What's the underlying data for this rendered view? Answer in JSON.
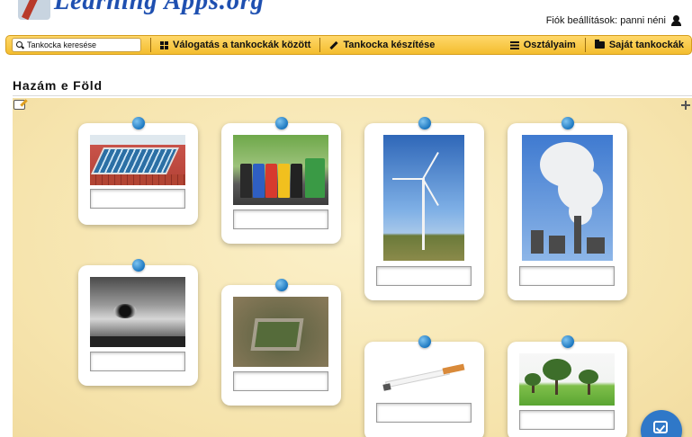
{
  "header": {
    "logo_text": "Learning Apps.org",
    "account_label": "Fiók beállítások: panni néni"
  },
  "nav": {
    "search_placeholder": "Tankocka keresése",
    "items": [
      {
        "label": "Válogatás a tankockák között",
        "icon": "grid-icon"
      },
      {
        "label": "Tankocka készítése",
        "icon": "pencil-icon"
      },
      {
        "label": "Osztályaim",
        "icon": "list-icon"
      },
      {
        "label": "Saját tankockák",
        "icon": "folder-icon"
      }
    ]
  },
  "page": {
    "title": "Hazám e Föld"
  },
  "board": {
    "cards": [
      {
        "image": "solar-panels-on-roof",
        "answer": ""
      },
      {
        "image": "recycling-bins",
        "answer": ""
      },
      {
        "image": "wind-turbine",
        "answer": ""
      },
      {
        "image": "factory-smoke",
        "answer": ""
      },
      {
        "image": "car-exhaust-pipe",
        "answer": ""
      },
      {
        "image": "compost-pit",
        "answer": ""
      },
      {
        "image": "cigarette",
        "answer": ""
      },
      {
        "image": "trees-on-grass",
        "answer": ""
      }
    ],
    "check_button_icon": "check-icon"
  },
  "colors": {
    "nav_bar": "#f3bd2e",
    "board_background": "#f6e4ad",
    "pin": "#1c77c0",
    "check_button": "#2f78c8"
  }
}
